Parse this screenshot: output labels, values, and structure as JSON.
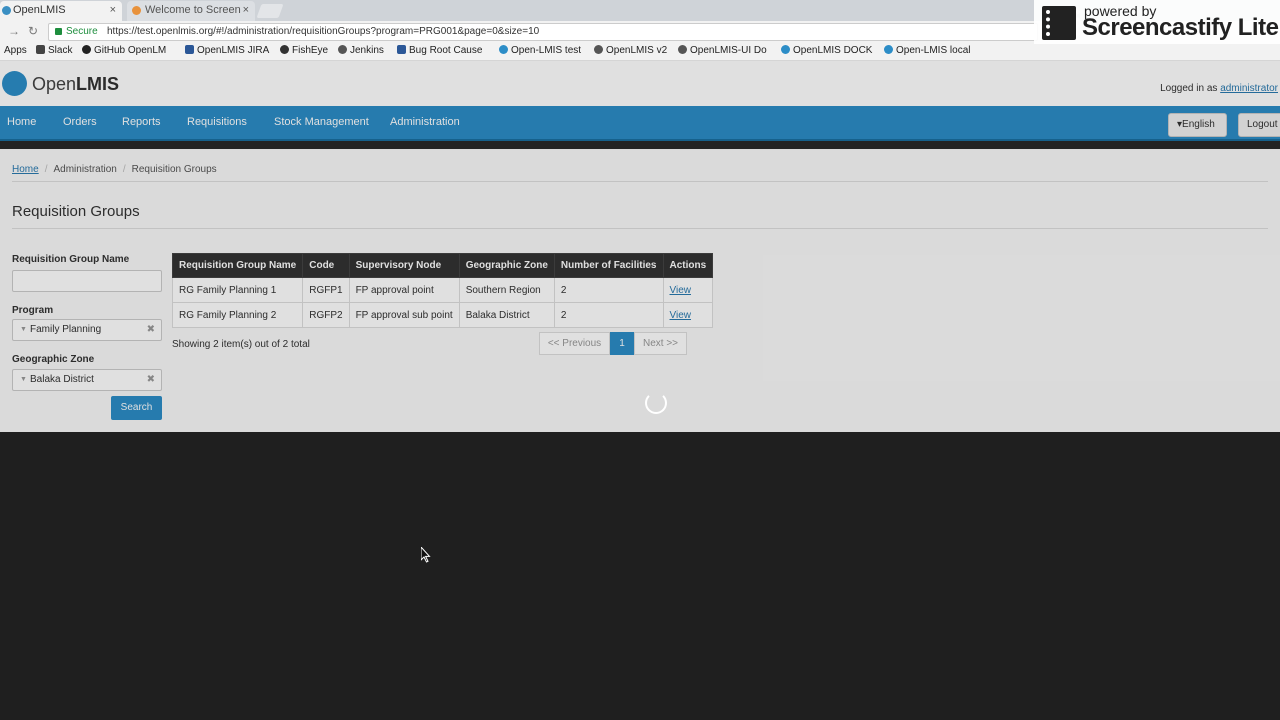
{
  "browser": {
    "tabs": [
      {
        "label": "OpenLMIS",
        "close": "×"
      },
      {
        "label": "Welcome to Screen",
        "close": "×"
      }
    ],
    "secure_label": "Secure",
    "url": "https://test.openlmis.org/#!/administration/requisitionGroups?program=PRG001&page=0&size=10",
    "bookmarks": [
      "Apps",
      "Slack",
      "GitHub OpenLM",
      "OpenLMIS JIRA",
      "FishEye",
      "Jenkins",
      "Bug Root Cause",
      "Open-LMIS test",
      "OpenLMIS v2",
      "OpenLMIS-UI Do",
      "OpenLMIS DOCK",
      "Open-LMIS local"
    ]
  },
  "watermark": {
    "powered_by": "powered by",
    "name": "Screencastify Lite"
  },
  "header": {
    "logo_prefix": "Open",
    "logo_suffix": "LMIS",
    "logged_in_prefix": "Logged in as",
    "logged_in_user": "administrator"
  },
  "nav": {
    "items": [
      "Home",
      "Orders",
      "Reports",
      "Requisitions",
      "Stock Management",
      "Administration"
    ],
    "language": "English",
    "logout": "Logout"
  },
  "breadcrumb": {
    "home": "Home",
    "admin": "Administration",
    "current": "Requisition Groups"
  },
  "page_title": "Requisition Groups",
  "filters": {
    "name_label": "Requisition Group Name",
    "name_value": "",
    "program_label": "Program",
    "program_value": "Family Planning",
    "zone_label": "Geographic Zone",
    "zone_value": "Balaka District",
    "search_label": "Search"
  },
  "table": {
    "headers": [
      "Requisition Group Name",
      "Code",
      "Supervisory Node",
      "Geographic Zone",
      "Number of Facilities",
      "Actions"
    ],
    "rows": [
      [
        "RG Family Planning 1",
        "RGFP1",
        "FP approval point",
        "Southern Region",
        "2",
        "View"
      ],
      [
        "RG Family Planning 2",
        "RGFP2",
        "FP approval sub point",
        "Balaka District",
        "2",
        "View"
      ]
    ]
  },
  "pagination": {
    "summary": "Showing 2 item(s) out of 2 total",
    "previous": "<< Previous",
    "current_page": "1",
    "next": "Next >>"
  },
  "colors": {
    "brand": "#2c8dc7",
    "header_dark": "#333333",
    "overlay": "#1f1f1f"
  }
}
